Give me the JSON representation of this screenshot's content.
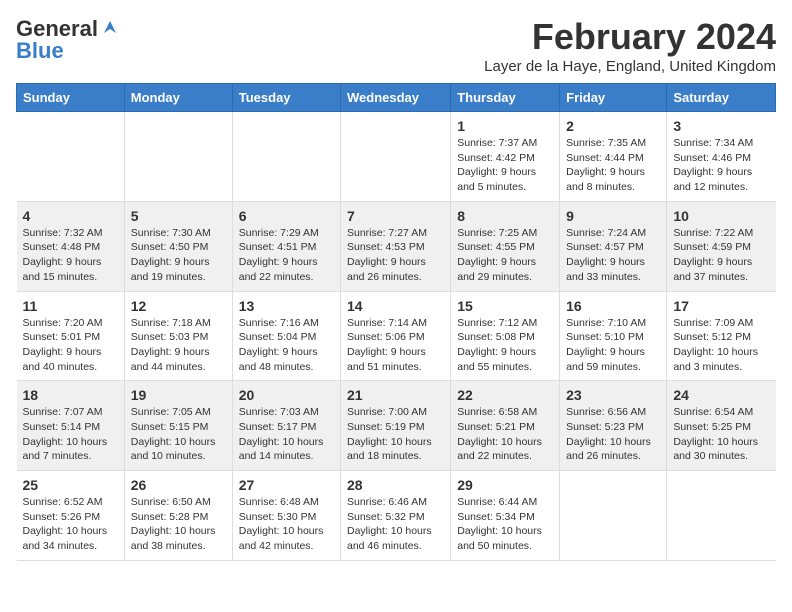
{
  "header": {
    "logo_general": "General",
    "logo_blue": "Blue",
    "month_title": "February 2024",
    "location": "Layer de la Haye, England, United Kingdom"
  },
  "days_of_week": [
    "Sunday",
    "Monday",
    "Tuesday",
    "Wednesday",
    "Thursday",
    "Friday",
    "Saturday"
  ],
  "weeks": [
    [
      {
        "day": "",
        "info": ""
      },
      {
        "day": "",
        "info": ""
      },
      {
        "day": "",
        "info": ""
      },
      {
        "day": "",
        "info": ""
      },
      {
        "day": "1",
        "info": "Sunrise: 7:37 AM\nSunset: 4:42 PM\nDaylight: 9 hours and 5 minutes."
      },
      {
        "day": "2",
        "info": "Sunrise: 7:35 AM\nSunset: 4:44 PM\nDaylight: 9 hours and 8 minutes."
      },
      {
        "day": "3",
        "info": "Sunrise: 7:34 AM\nSunset: 4:46 PM\nDaylight: 9 hours and 12 minutes."
      }
    ],
    [
      {
        "day": "4",
        "info": "Sunrise: 7:32 AM\nSunset: 4:48 PM\nDaylight: 9 hours and 15 minutes."
      },
      {
        "day": "5",
        "info": "Sunrise: 7:30 AM\nSunset: 4:50 PM\nDaylight: 9 hours and 19 minutes."
      },
      {
        "day": "6",
        "info": "Sunrise: 7:29 AM\nSunset: 4:51 PM\nDaylight: 9 hours and 22 minutes."
      },
      {
        "day": "7",
        "info": "Sunrise: 7:27 AM\nSunset: 4:53 PM\nDaylight: 9 hours and 26 minutes."
      },
      {
        "day": "8",
        "info": "Sunrise: 7:25 AM\nSunset: 4:55 PM\nDaylight: 9 hours and 29 minutes."
      },
      {
        "day": "9",
        "info": "Sunrise: 7:24 AM\nSunset: 4:57 PM\nDaylight: 9 hours and 33 minutes."
      },
      {
        "day": "10",
        "info": "Sunrise: 7:22 AM\nSunset: 4:59 PM\nDaylight: 9 hours and 37 minutes."
      }
    ],
    [
      {
        "day": "11",
        "info": "Sunrise: 7:20 AM\nSunset: 5:01 PM\nDaylight: 9 hours and 40 minutes."
      },
      {
        "day": "12",
        "info": "Sunrise: 7:18 AM\nSunset: 5:03 PM\nDaylight: 9 hours and 44 minutes."
      },
      {
        "day": "13",
        "info": "Sunrise: 7:16 AM\nSunset: 5:04 PM\nDaylight: 9 hours and 48 minutes."
      },
      {
        "day": "14",
        "info": "Sunrise: 7:14 AM\nSunset: 5:06 PM\nDaylight: 9 hours and 51 minutes."
      },
      {
        "day": "15",
        "info": "Sunrise: 7:12 AM\nSunset: 5:08 PM\nDaylight: 9 hours and 55 minutes."
      },
      {
        "day": "16",
        "info": "Sunrise: 7:10 AM\nSunset: 5:10 PM\nDaylight: 9 hours and 59 minutes."
      },
      {
        "day": "17",
        "info": "Sunrise: 7:09 AM\nSunset: 5:12 PM\nDaylight: 10 hours and 3 minutes."
      }
    ],
    [
      {
        "day": "18",
        "info": "Sunrise: 7:07 AM\nSunset: 5:14 PM\nDaylight: 10 hours and 7 minutes."
      },
      {
        "day": "19",
        "info": "Sunrise: 7:05 AM\nSunset: 5:15 PM\nDaylight: 10 hours and 10 minutes."
      },
      {
        "day": "20",
        "info": "Sunrise: 7:03 AM\nSunset: 5:17 PM\nDaylight: 10 hours and 14 minutes."
      },
      {
        "day": "21",
        "info": "Sunrise: 7:00 AM\nSunset: 5:19 PM\nDaylight: 10 hours and 18 minutes."
      },
      {
        "day": "22",
        "info": "Sunrise: 6:58 AM\nSunset: 5:21 PM\nDaylight: 10 hours and 22 minutes."
      },
      {
        "day": "23",
        "info": "Sunrise: 6:56 AM\nSunset: 5:23 PM\nDaylight: 10 hours and 26 minutes."
      },
      {
        "day": "24",
        "info": "Sunrise: 6:54 AM\nSunset: 5:25 PM\nDaylight: 10 hours and 30 minutes."
      }
    ],
    [
      {
        "day": "25",
        "info": "Sunrise: 6:52 AM\nSunset: 5:26 PM\nDaylight: 10 hours and 34 minutes."
      },
      {
        "day": "26",
        "info": "Sunrise: 6:50 AM\nSunset: 5:28 PM\nDaylight: 10 hours and 38 minutes."
      },
      {
        "day": "27",
        "info": "Sunrise: 6:48 AM\nSunset: 5:30 PM\nDaylight: 10 hours and 42 minutes."
      },
      {
        "day": "28",
        "info": "Sunrise: 6:46 AM\nSunset: 5:32 PM\nDaylight: 10 hours and 46 minutes."
      },
      {
        "day": "29",
        "info": "Sunrise: 6:44 AM\nSunset: 5:34 PM\nDaylight: 10 hours and 50 minutes."
      },
      {
        "day": "",
        "info": ""
      },
      {
        "day": "",
        "info": ""
      }
    ]
  ]
}
